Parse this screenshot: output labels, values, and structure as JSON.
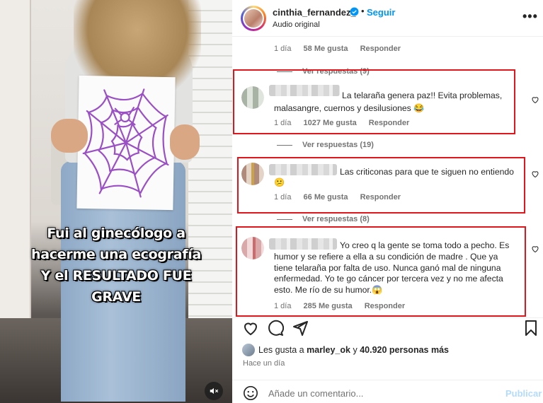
{
  "video": {
    "caption_lines": [
      "Fui al ginecólogo a",
      "hacerme una ecografía",
      "Y el RESULTADO FUE",
      "GRAVE"
    ]
  },
  "post": {
    "username": "cinthia_fernandez_",
    "separator": "•",
    "follow_label": "Seguir",
    "audio_label": "Audio original",
    "more_label": "•••"
  },
  "comments_top": {
    "time": "1 día",
    "likes": "58 Me gusta",
    "reply": "Responder",
    "view_replies": "Ver respuestas (9)"
  },
  "comments": [
    {
      "text_lines": [
        "La telaraña genera paz!! Evita problemas,",
        "malasangre, cuernos y desilusiones 😂"
      ],
      "time": "1 día",
      "likes": "1027 Me gusta",
      "reply": "Responder",
      "view_replies": "Ver respuestas (19)"
    },
    {
      "text_lines": [
        "Las criticonas para que te siguen no entiendo",
        "😕"
      ],
      "time": "1 día",
      "likes": "66 Me gusta",
      "reply": "Responder",
      "view_replies": "Ver respuestas (8)"
    },
    {
      "text_lines": [
        "Yo creo q la gente se toma todo a pecho. Es",
        "humor y se refiere a ella a su condición de madre . Que ya",
        "tiene telaraña por falta de uso. Nunca ganó mal de ninguna",
        "enfermedad. Yo te go cáncer por tercera vez y no me afecta",
        "esto. Me río de su humor.😱"
      ],
      "time": "1 día",
      "likes": "285 Me gusta",
      "reply": "Responder"
    }
  ],
  "likes_summary": {
    "prefix": "Les gusta a",
    "user": "marley_ok",
    "connector": "y",
    "count": "40.920 personas más"
  },
  "time_ago": "Hace un día",
  "composer": {
    "placeholder": "Añade un comentario...",
    "publish_label": "Publicar"
  },
  "colors": {
    "accent": "#0095f6",
    "highlight_box": "#e0161c",
    "muted_text": "#737373",
    "spider_web": "#9a4fc4"
  },
  "icons": [
    "verified-icon",
    "more-options-icon",
    "heart-icon",
    "comment-icon",
    "share-icon",
    "bookmark-icon",
    "emoji-icon",
    "mute-icon"
  ]
}
